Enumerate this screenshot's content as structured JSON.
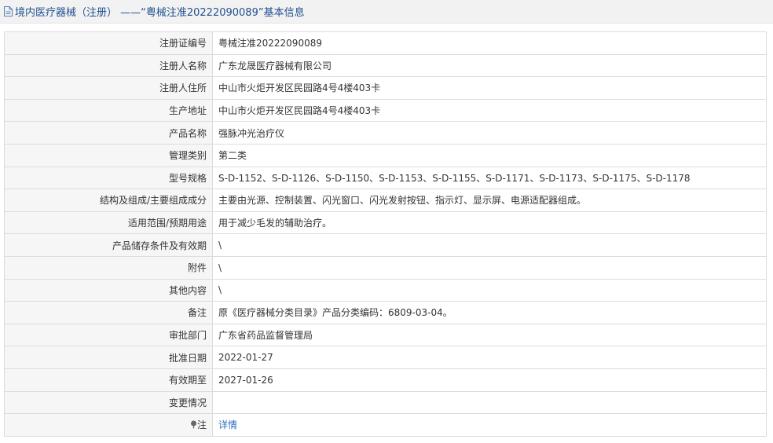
{
  "header": {
    "title": "境内医疗器械（注册） ——“粤械注准20222090089”基本信息",
    "icon": "document-icon"
  },
  "rows": [
    {
      "label": "注册证编号",
      "value": "粤械注准20222090089"
    },
    {
      "label": "注册人名称",
      "value": "广东龙晟医疗器械有限公司"
    },
    {
      "label": "注册人住所",
      "value": "中山市火炬开发区民园路4号4楼403卡"
    },
    {
      "label": "生产地址",
      "value": "中山市火炬开发区民园路4号4楼403卡"
    },
    {
      "label": "产品名称",
      "value": "强脉冲光治疗仪"
    },
    {
      "label": "管理类别",
      "value": "第二类"
    },
    {
      "label": "型号规格",
      "value": "S-D-1152、S-D-1126、S-D-1150、S-D-1153、S-D-1155、S-D-1171、S-D-1173、S-D-1175、S-D-1178"
    },
    {
      "label": "结构及组成/主要组成成分",
      "value": "主要由光源、控制装置、闪光窗口、闪光发射按钮、指示灯、显示屏、电源适配器组成。"
    },
    {
      "label": "适用范围/预期用途",
      "value": "用于减少毛发的辅助治疗。"
    },
    {
      "label": "产品储存条件及有效期",
      "value": "\\"
    },
    {
      "label": "附件",
      "value": "\\"
    },
    {
      "label": "其他内容",
      "value": "\\"
    },
    {
      "label": "备注",
      "value": "原《医疗器械分类目录》产品分类编码：6809-03-04。"
    },
    {
      "label": "审批部门",
      "value": "广东省药品监督管理局"
    },
    {
      "label": "批准日期",
      "value": "2022-01-27"
    },
    {
      "label": "有效期至",
      "value": "2027-01-26"
    },
    {
      "label": "变更情况",
      "value": ""
    }
  ],
  "note_row": {
    "label": "注",
    "icon": "pin-icon",
    "link_text": "详情"
  }
}
